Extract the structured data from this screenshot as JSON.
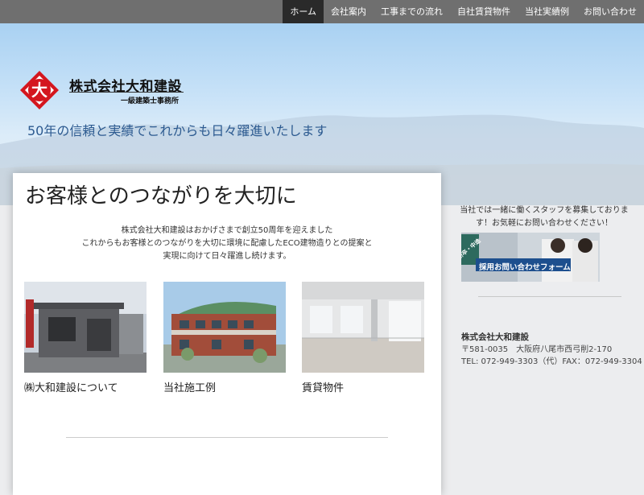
{
  "nav": {
    "items": [
      "ホーム",
      "会社案内",
      "工事までの流れ",
      "自社賃貸物件",
      "当社実績例",
      "お問い合わせ"
    ],
    "active_index": 0
  },
  "header": {
    "logo_glyph": "大",
    "company_name": "株式会社大和建設",
    "company_sub": "一級建築士事務所",
    "tagline": "50年の信頼と実績でこれからも日々躍進いたします"
  },
  "main": {
    "title": "お客様とのつながりを大切に",
    "intro": [
      "株式会社大和建設はおかげさまで創立50周年を迎えました",
      "これからもお客様とのつながりを大切に環境に配慮したECO建物造りとの提案と",
      "実現に向けて日々躍進し続けます。"
    ],
    "tiles": [
      {
        "caption": "㈱大和建設について"
      },
      {
        "caption": "当社施工例"
      },
      {
        "caption": "賃貸物件"
      }
    ]
  },
  "sidebar": {
    "recruit_text": [
      "当社では一緒に働くスタッフを募集しております！お気軽にお問い合わせください！"
    ],
    "banner_badge": "新卒・中途",
    "banner_label": "採用お問い合わせフォーム",
    "company_name": "株式会社大和建設",
    "postal_address": "〒581-0035　大阪府八尾市西弓削2-170",
    "tel_fax": "TEL: 072-949-3303（代）FAX：072-949-3304"
  },
  "colors": {
    "nav_bg": "#6f6f6f",
    "nav_active": "#2a2a2a",
    "logo_red": "#d4161e",
    "tagline": "#2c5a90"
  }
}
